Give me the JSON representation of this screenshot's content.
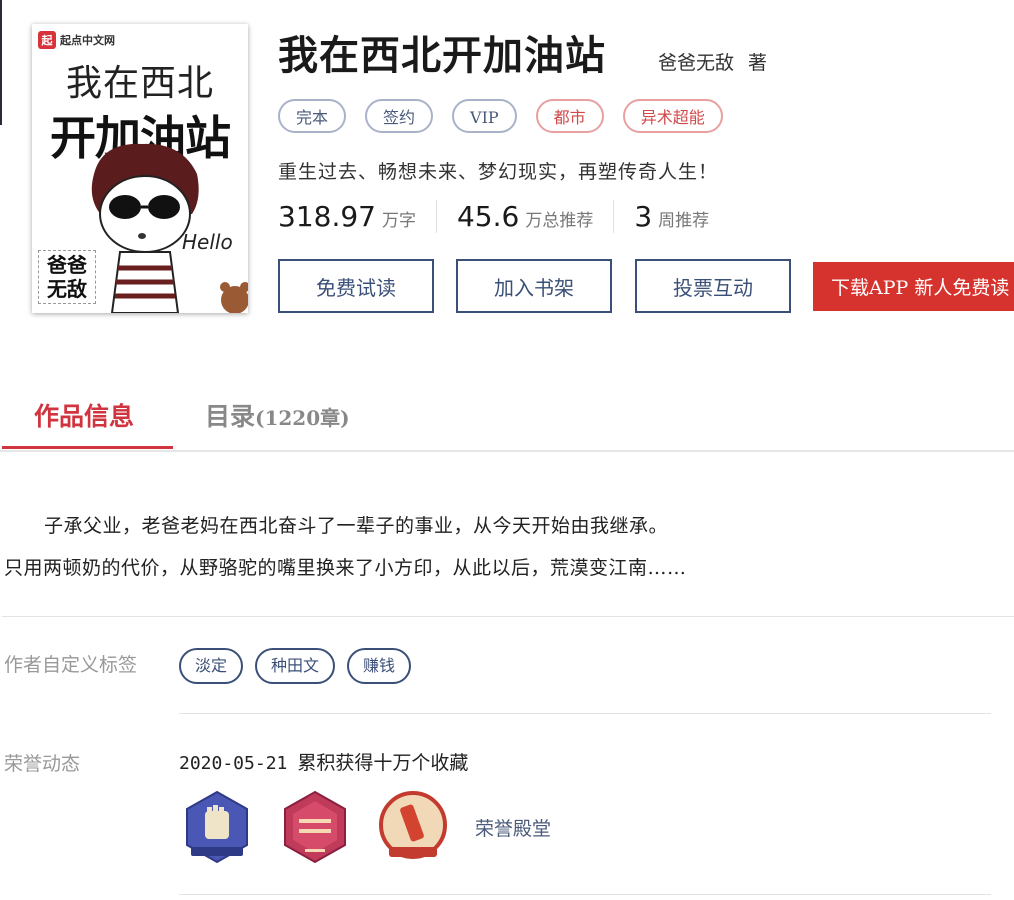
{
  "cover": {
    "logo_text": "起点中文网",
    "logo_mark": "起",
    "title_line1": "我在西北",
    "title_line2": "开加油站",
    "author_stamp": "爸爸无敌",
    "hello_text": "Hello"
  },
  "book": {
    "title": "我在西北开加油站",
    "author": "爸爸无敌",
    "author_suffix": "著",
    "tags": [
      {
        "label": "完本",
        "style": "gray"
      },
      {
        "label": "签约",
        "style": "gray"
      },
      {
        "label": "VIP",
        "style": "gray"
      },
      {
        "label": "都市",
        "style": "red"
      },
      {
        "label": "异术超能",
        "style": "red"
      }
    ],
    "intro": "重生过去、畅想未来、梦幻现实，再塑传奇人生！",
    "stats": [
      {
        "value": "318.97",
        "unit": "万字"
      },
      {
        "value": "45.6",
        "unit": "万总推荐"
      },
      {
        "value": "3",
        "unit": "周推荐"
      }
    ]
  },
  "actions": {
    "read_free": "免费试读",
    "add_shelf": "加入书架",
    "vote": "投票互动",
    "download_app": "下载APP  新人免费读"
  },
  "tabs": {
    "info": "作品信息",
    "toc": "目录",
    "toc_count": "(1220章)"
  },
  "description": {
    "line1": "子承父业，老爸老妈在西北奋斗了一辈子的事业，从今天开始由我继承。",
    "line2": "只用两顿奶的代价，从野骆驼的嘴里换来了小方印，从此以后，荒漠变江南……"
  },
  "custom_tags": {
    "label": "作者自定义标签",
    "items": [
      "淡定",
      "种田文",
      "赚钱"
    ]
  },
  "honor": {
    "label": "荣誉动态",
    "date": "2020-05-21",
    "text": "累积获得十万个收藏",
    "badges": [
      "fist-badge-icon",
      "quality-channel-badge-icon",
      "level-up-badge-icon"
    ],
    "hall_label": "荣誉殿堂"
  },
  "colors": {
    "accent_red": "#d0343f",
    "navy": "#3b5078",
    "app_button": "#d7332e"
  }
}
